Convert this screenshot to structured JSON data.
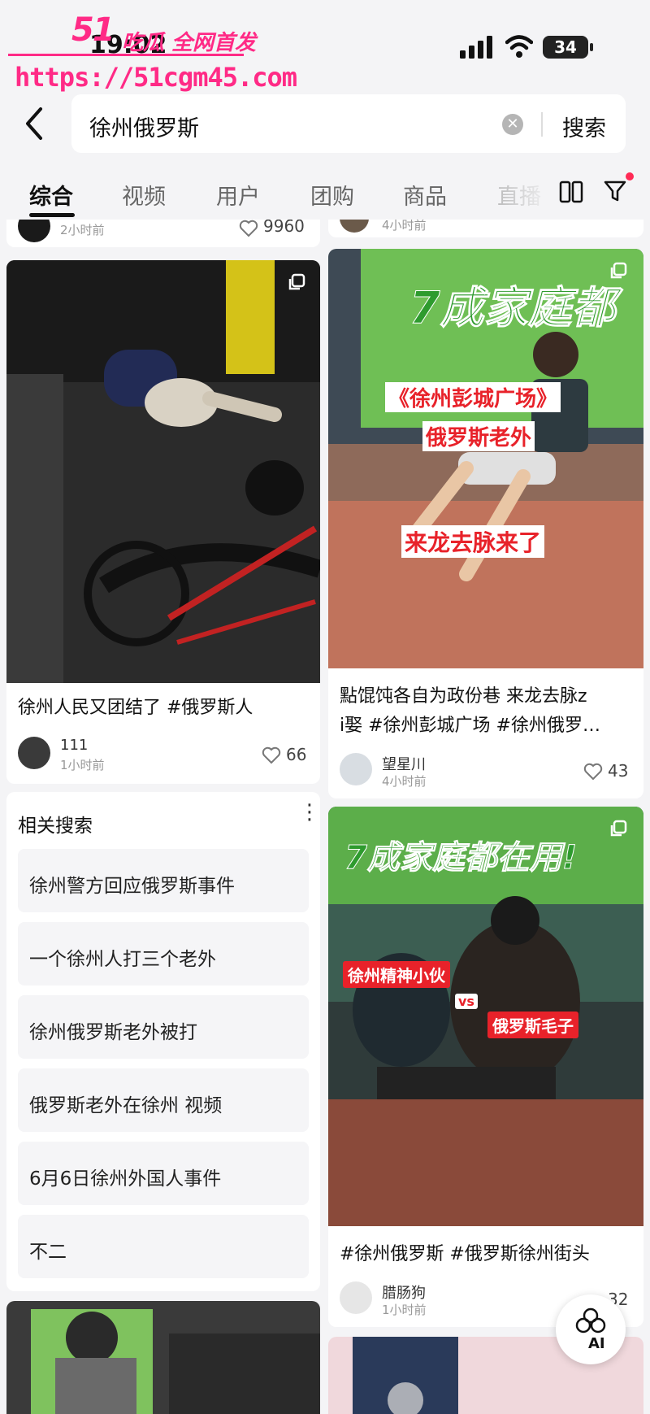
{
  "status_bar": {
    "time": "19:02",
    "battery": "34"
  },
  "watermark": {
    "logo": "51",
    "tag": "吃瓜 全网首发",
    "url": "https://51cgm45.com"
  },
  "search": {
    "query": "徐州俄罗斯",
    "button": "搜索"
  },
  "tabs": [
    {
      "label": "综合",
      "active": true
    },
    {
      "label": "视频"
    },
    {
      "label": "用户"
    },
    {
      "label": "团购"
    },
    {
      "label": "商品"
    },
    {
      "label": "直播"
    }
  ],
  "top_partial": {
    "left_time": "2小时前",
    "left_likes": "9960",
    "right_time": "4小时前"
  },
  "cards": [
    {
      "title": "徐州人民又团结了 #俄罗斯人",
      "user": "111",
      "time": "1小时前",
      "likes": "66"
    },
    {
      "title_line1": "點馄饨各自为政份巷 来龙去脉z",
      "title_line2": "i娶 #徐州彭城广场 #徐州俄罗…",
      "overlay": [
        "《徐州彭城广场》",
        "俄罗斯老外",
        "来龙去脉来了"
      ],
      "banner": "7成家庭都",
      "user": "望星川",
      "time": "4小时前",
      "likes": "43"
    },
    {
      "title": "#徐州俄罗斯 #俄罗斯徐州街头",
      "overlay_banner": "7成家庭都在用!",
      "label_left": "徐州精神小伙",
      "label_vs": "vs",
      "label_right": "俄罗斯毛子",
      "user": "腊肠狗",
      "time": "1小时前",
      "likes": "32"
    }
  ],
  "related": {
    "title": "相关搜索",
    "items": [
      "徐州警方回应俄罗斯事件",
      "一个徐州人打三个老外",
      "徐州俄罗斯老外被打",
      "俄罗斯老外在徐州 视频",
      "6月6日徐州外国人事件",
      "不二"
    ]
  },
  "ai_button": {
    "label": "AI"
  },
  "colors": {
    "accent": "#ff2a55",
    "watermark": "#ff2a86",
    "overlay_red": "#e8222a",
    "banner_green": "#3aa52d"
  }
}
